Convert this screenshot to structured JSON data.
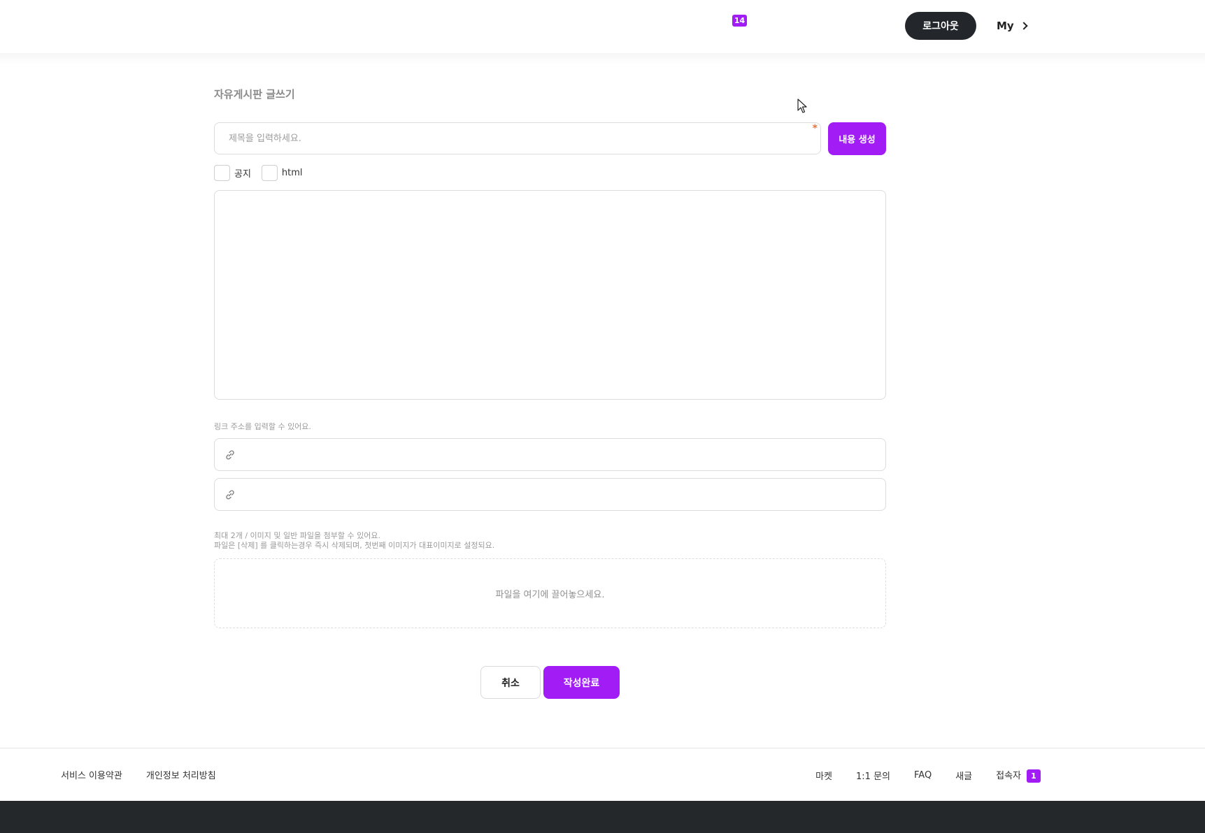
{
  "header": {
    "notification_count": "14",
    "logout_label": "로그아웃",
    "my_label": "My"
  },
  "form": {
    "page_title": "자유게시판 글쓰기",
    "title_placeholder": "제목을 입력하세요.",
    "title_value": "",
    "required_mark": "*",
    "generate_label": "내용 생성",
    "checkboxes": [
      {
        "label": "공지",
        "checked": false
      },
      {
        "label": "html",
        "checked": false
      }
    ],
    "editor_content": "",
    "link_hint": "링크 주소를 입력할 수 있어요.",
    "links": [
      "",
      ""
    ],
    "file_hint_line1": "최대 2개 / 이미지 및 일반 파일을 첨부할 수 있어요.",
    "file_hint_line2": "파일은 [삭제] 를 클릭하는경우 즉시 삭제되며, 첫번째 이미지가 대표이미지로 설정되요.",
    "dropzone_label": "파일을 여기에 끌어놓으세요.",
    "cancel_label": "취소",
    "submit_label": "작성완료"
  },
  "footer": {
    "left_links": [
      "서비스 이용약관",
      "개인정보 처리방침"
    ],
    "right_links": [
      "마켓",
      "1:1 문의",
      "FAQ",
      "새글"
    ],
    "visitor_label": "접속자",
    "visitor_count": "1"
  },
  "colors": {
    "accent": "#a21cf5",
    "dark": "#23272b",
    "footer_dark": "#25282b",
    "required": "#e8743b"
  },
  "icons": {
    "my_chevron": "chevron-right-icon",
    "link": "link-icon",
    "cursor": "mouse-cursor-icon"
  }
}
